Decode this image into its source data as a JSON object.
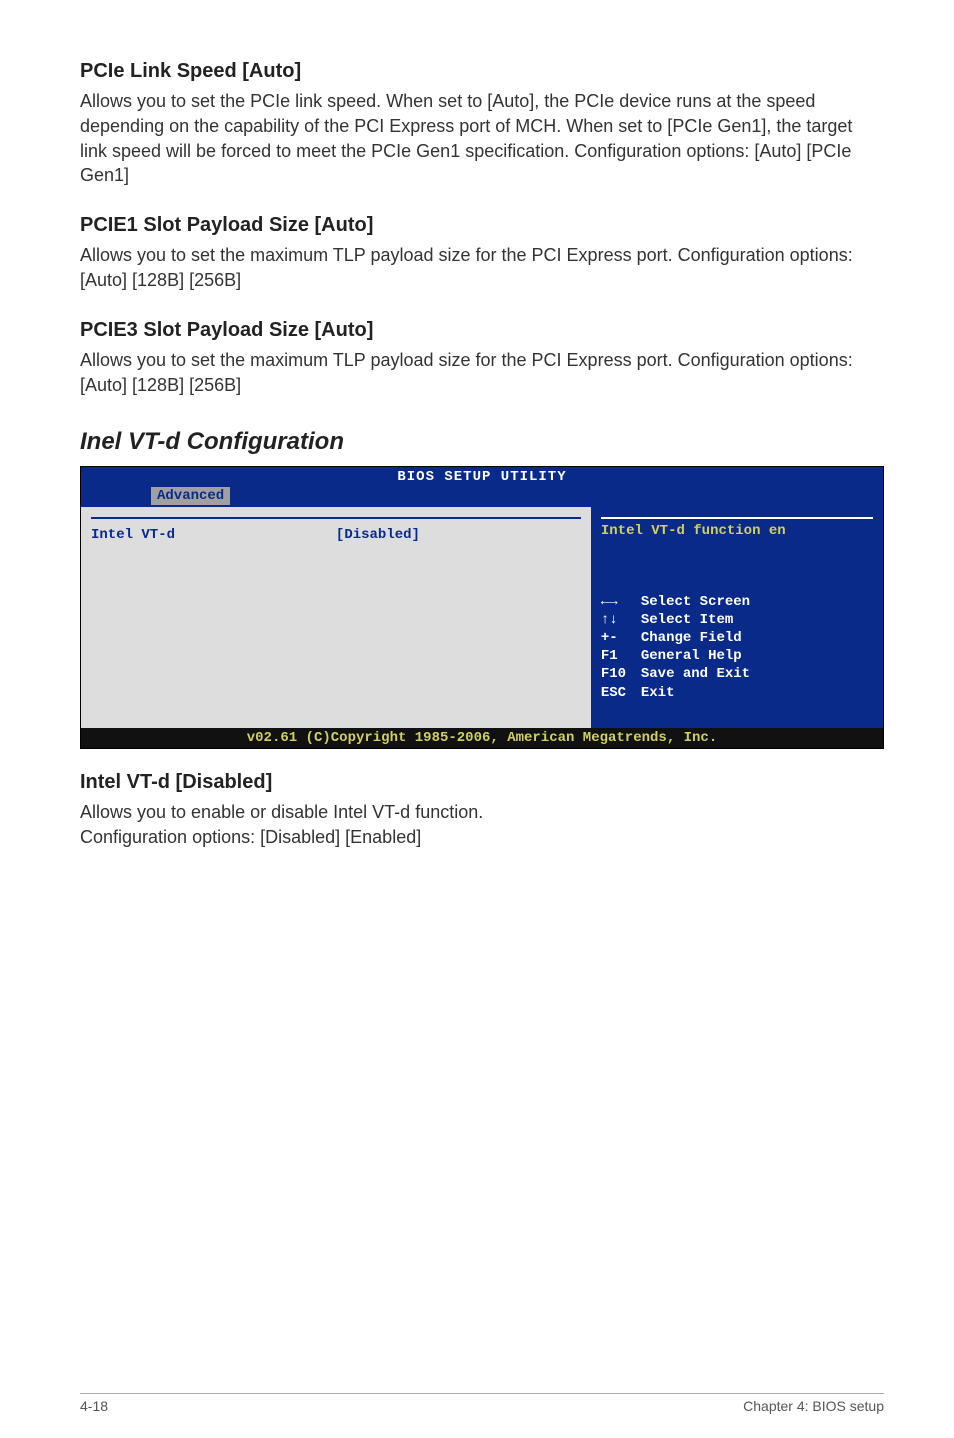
{
  "s1": {
    "heading": "PCIe Link Speed [Auto]",
    "body": "Allows you to set the PCIe link speed. When set to [Auto], the PCIe device runs at the speed depending on the capability of the PCI Express port of MCH. When set to [PCIe Gen1], the target link speed will be forced to meet the PCIe Gen1 specification. Configuration options: [Auto] [PCIe Gen1]"
  },
  "s2": {
    "heading": "PCIE1 Slot Payload Size [Auto]",
    "body": "Allows you to set the maximum TLP payload size for the PCI Express port. Configuration options: [Auto] [128B] [256B]"
  },
  "s3": {
    "heading": "PCIE3 Slot Payload Size [Auto]",
    "body": "Allows you to set the maximum TLP payload size for the PCI Express port. Configuration options: [Auto] [128B] [256B]"
  },
  "config_heading": "Inel VT-d Configuration",
  "bios": {
    "title": "BIOS SETUP UTILITY",
    "tab": "Advanced",
    "item_label": "Intel VT-d",
    "item_value": "[Disabled]",
    "desc": "Intel VT-d function en",
    "help": [
      {
        "key": "←→",
        "label": "Select Screen"
      },
      {
        "key": "↑↓",
        "label": "Select Item"
      },
      {
        "key": "+-",
        "label": "Change Field"
      },
      {
        "key": "F1",
        "label": "General Help"
      },
      {
        "key": "F10",
        "label": "Save and Exit"
      },
      {
        "key": "ESC",
        "label": "Exit"
      }
    ],
    "footer": "v02.61 (C)Copyright 1985-2006, American Megatrends, Inc."
  },
  "s4": {
    "heading": "Intel VT-d [Disabled]",
    "body": "Allows you to enable or disable Intel VT-d function. Configuration options: [Disabled] [Enabled]"
  },
  "page": {
    "left": "4-18",
    "right": "Chapter 4: BIOS setup"
  }
}
